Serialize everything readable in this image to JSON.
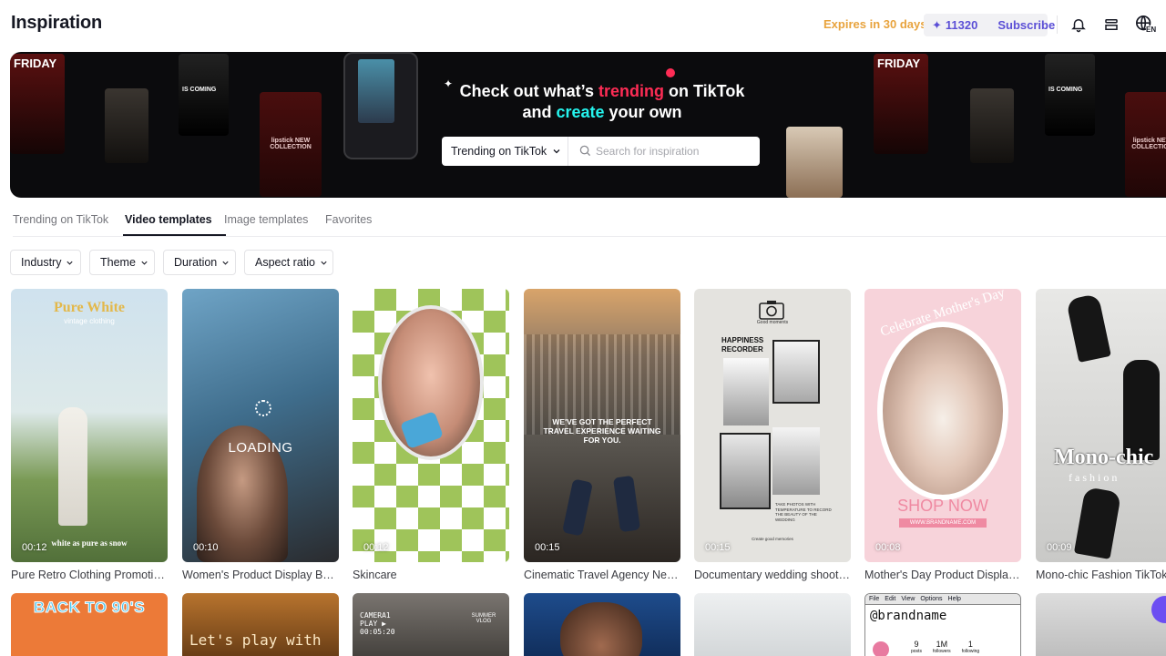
{
  "header": {
    "title": "Inspiration",
    "expires": "Expires in 30 days",
    "credits": "11320",
    "subscribe": "Subscribe",
    "lang_badge": "EN"
  },
  "banner": {
    "line1_prefix": "Check out what’s ",
    "line1_highlight": "trending",
    "line1_suffix": " on TikTok",
    "line2_prefix": "and ",
    "line2_highlight": "create",
    "line2_suffix": " your own",
    "select_value": "Trending on TikTok",
    "search_placeholder": "Search for inspiration",
    "thumb_texts": [
      "FRIDAY",
      "IS COMING",
      "lipstick NEW COLLECTION",
      "FRIDAY",
      "IS COMING",
      "lipstick NEW COLLECTION"
    ]
  },
  "tabs": [
    "Trending on TikTok",
    "Video templates",
    "Image templates",
    "Favorites"
  ],
  "active_tab": "Video templates",
  "filters": [
    "Industry",
    "Theme",
    "Duration",
    "Aspect ratio"
  ],
  "cards": [
    {
      "title": "Pure Retro Clothing Promotion...",
      "duration": "00:12",
      "overlay": "Pure White",
      "overlay_sub": "vintage clothing",
      "caption": "white as pure as snow"
    },
    {
      "title": "Women's Product Display Beat...",
      "duration": "00:10",
      "overlay": "LOADING"
    },
    {
      "title": "Skincare",
      "duration": "00:12"
    },
    {
      "title": "Cinematic Travel Agency New ...",
      "duration": "00:15",
      "overlay": "WE'VE GOT THE PERFECT TRAVEL EXPERIENCE WAITING FOR YOU."
    },
    {
      "title": "Documentary wedding shooting",
      "duration": "00:15",
      "overlay": "HAPPINESS RECORDER",
      "overlay_top": "Good moments",
      "overlay_sub": "TAKE PHOTOS WITH TEMPERATURE TO RECORD THE BEAUTY OF THE WEDDING",
      "overlay_bottom": "Create good memories"
    },
    {
      "title": "Mother's Day Product Display ...",
      "duration": "00:08",
      "overlay": "Celebrate Mother's Day",
      "overlay_sub": "SHOP NOW",
      "overlay_bottom": "WWW.BRANDNAME.COM"
    },
    {
      "title": "Mono-chic Fashion TikTok S...",
      "duration": "00:09",
      "overlay": "Mono-chic",
      "overlay_sub": "fashion"
    }
  ],
  "row2": {
    "card1": "BACK TO 90'S",
    "card2": "Let's play with",
    "card3": "CAMERA1 PLAY ▶ 00:05:20",
    "card3_sub": "SUMMER VLOG",
    "card6_menu": [
      "File",
      "Edit",
      "View",
      "Options",
      "Help"
    ],
    "card6_handle": "@brandname",
    "card6_stats": [
      {
        "value": "9",
        "label": "posts"
      },
      {
        "value": "1M",
        "label": "followers"
      },
      {
        "value": "1",
        "label": "following"
      }
    ]
  },
  "colors": {
    "accent": "#5b4fd6",
    "expires": "#e8a33d",
    "pink": "#fe2c55",
    "cyan": "#25f4ee"
  }
}
